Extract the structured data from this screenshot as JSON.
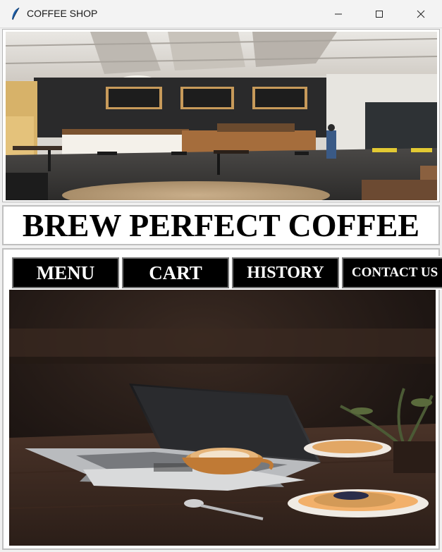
{
  "window": {
    "title": "COFFEE SHOP",
    "icon": "feather-icon",
    "controls": [
      "minimize-icon",
      "maximize-icon",
      "close-icon"
    ]
  },
  "banner": {
    "headline": "BREW PERFECT COFFEE"
  },
  "nav": {
    "items": [
      {
        "label": "MENU"
      },
      {
        "label": "CART"
      },
      {
        "label": "HISTORY"
      },
      {
        "label": "CONTACT US"
      }
    ]
  },
  "images": {
    "top": "cafe-interior-photo",
    "bottom": "laptop-latte-pastry-photo"
  },
  "colors": {
    "nav_button_bg": "#000000",
    "nav_button_text": "#ffffff",
    "headline_text": "#000000"
  }
}
